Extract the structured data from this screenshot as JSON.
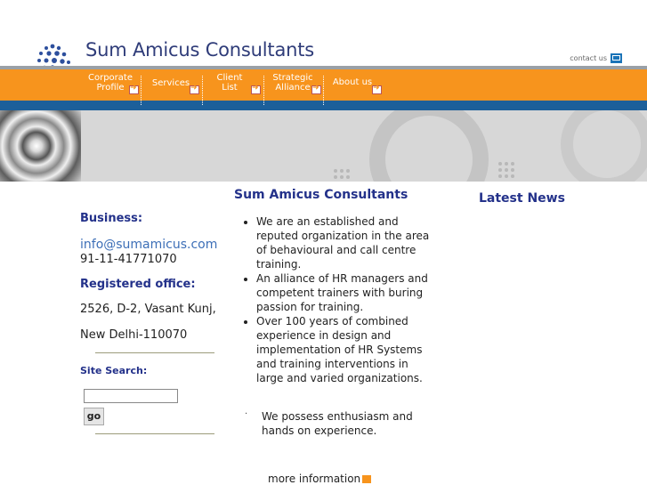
{
  "header": {
    "title": "Sum Amicus Consultants",
    "contact": "contact us"
  },
  "nav": [
    {
      "label_1": "Corporate",
      "label_2": "Profile"
    },
    {
      "label_1": "Services"
    },
    {
      "label_1": "Client",
      "label_2": "List"
    },
    {
      "label_1": "Strategic",
      "label_2": "Alliance"
    },
    {
      "label_1": "About us"
    }
  ],
  "left": {
    "business_label": "Business:",
    "email": "info@sumamicus.com",
    "phone": "91-11-41771070",
    "office_label": "Registered office:",
    "address_1": "2526, D-2, Vasant Kunj,",
    "address_2": "New Delhi-110070",
    "search_label": "Site Search:",
    "go_label": "go"
  },
  "middle": {
    "title": "Sum Amicus Consultants",
    "bullets": [
      "We are an established and reputed organization in the area of behavioural and call centre training.",
      "An alliance of HR managers and competent trainers with buring passion for training.",
      "Over 100 years of combined experience in design and implementation of HR Systems and training interventions in large and varied organizations."
    ],
    "extra": "We possess enthusiasm and hands on experience.",
    "more": "more information"
  },
  "right": {
    "title": "Latest News"
  },
  "colors": {
    "orange": "#f7941d",
    "blue": "#1c5f9a",
    "title": "#23318a"
  }
}
